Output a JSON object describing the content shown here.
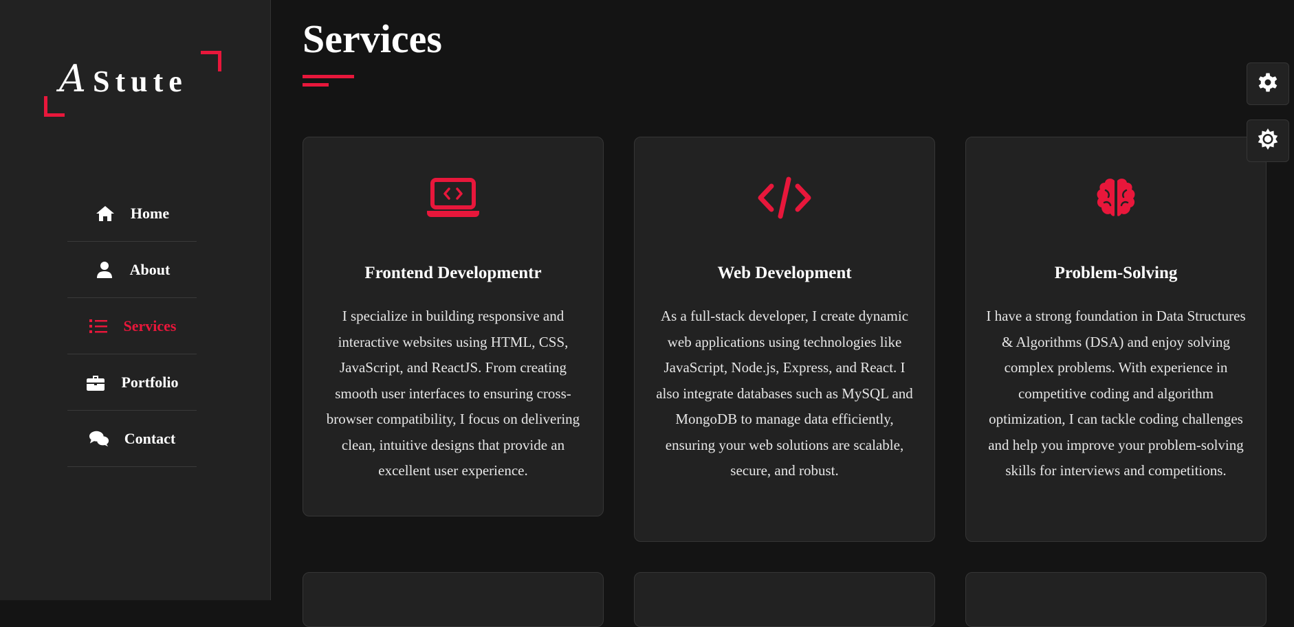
{
  "brand": {
    "logo_letter": "A",
    "logo_rest": "Stute",
    "accent_color": "#e8173b"
  },
  "nav": {
    "items": [
      {
        "label": "Home",
        "icon": "home-icon",
        "active": false
      },
      {
        "label": "About",
        "icon": "user-icon",
        "active": false
      },
      {
        "label": "Services",
        "icon": "list-icon",
        "active": true
      },
      {
        "label": "Portfolio",
        "icon": "briefcase-icon",
        "active": false
      },
      {
        "label": "Contact",
        "icon": "chat-icon",
        "active": false
      }
    ]
  },
  "page": {
    "title": "Services"
  },
  "services": [
    {
      "icon": "laptop-code-icon",
      "title": "Frontend Developmentr",
      "text": "I specialize in building responsive and interactive websites using HTML, CSS, JavaScript, and ReactJS. From creating smooth user interfaces to ensuring cross-browser compatibility, I focus on delivering clean, intuitive designs that provide an excellent user experience."
    },
    {
      "icon": "code-icon",
      "title": "Web Development",
      "text": "As a full-stack developer, I create dynamic web applications using technologies like JavaScript, Node.js, Express, and React. I also integrate databases such as MySQL and MongoDB to manage data efficiently, ensuring your web solutions are scalable, secure, and robust."
    },
    {
      "icon": "brain-icon",
      "title": "Problem-Solving",
      "text": "I have a strong foundation in Data Structures & Algorithms (DSA) and enjoy solving complex problems. With experience in competitive coding and algorithm optimization, I can tackle coding challenges and help you improve your problem-solving skills for interviews and competitions."
    }
  ],
  "side_controls": [
    {
      "icon": "gear-icon"
    },
    {
      "icon": "sun-icon"
    }
  ]
}
